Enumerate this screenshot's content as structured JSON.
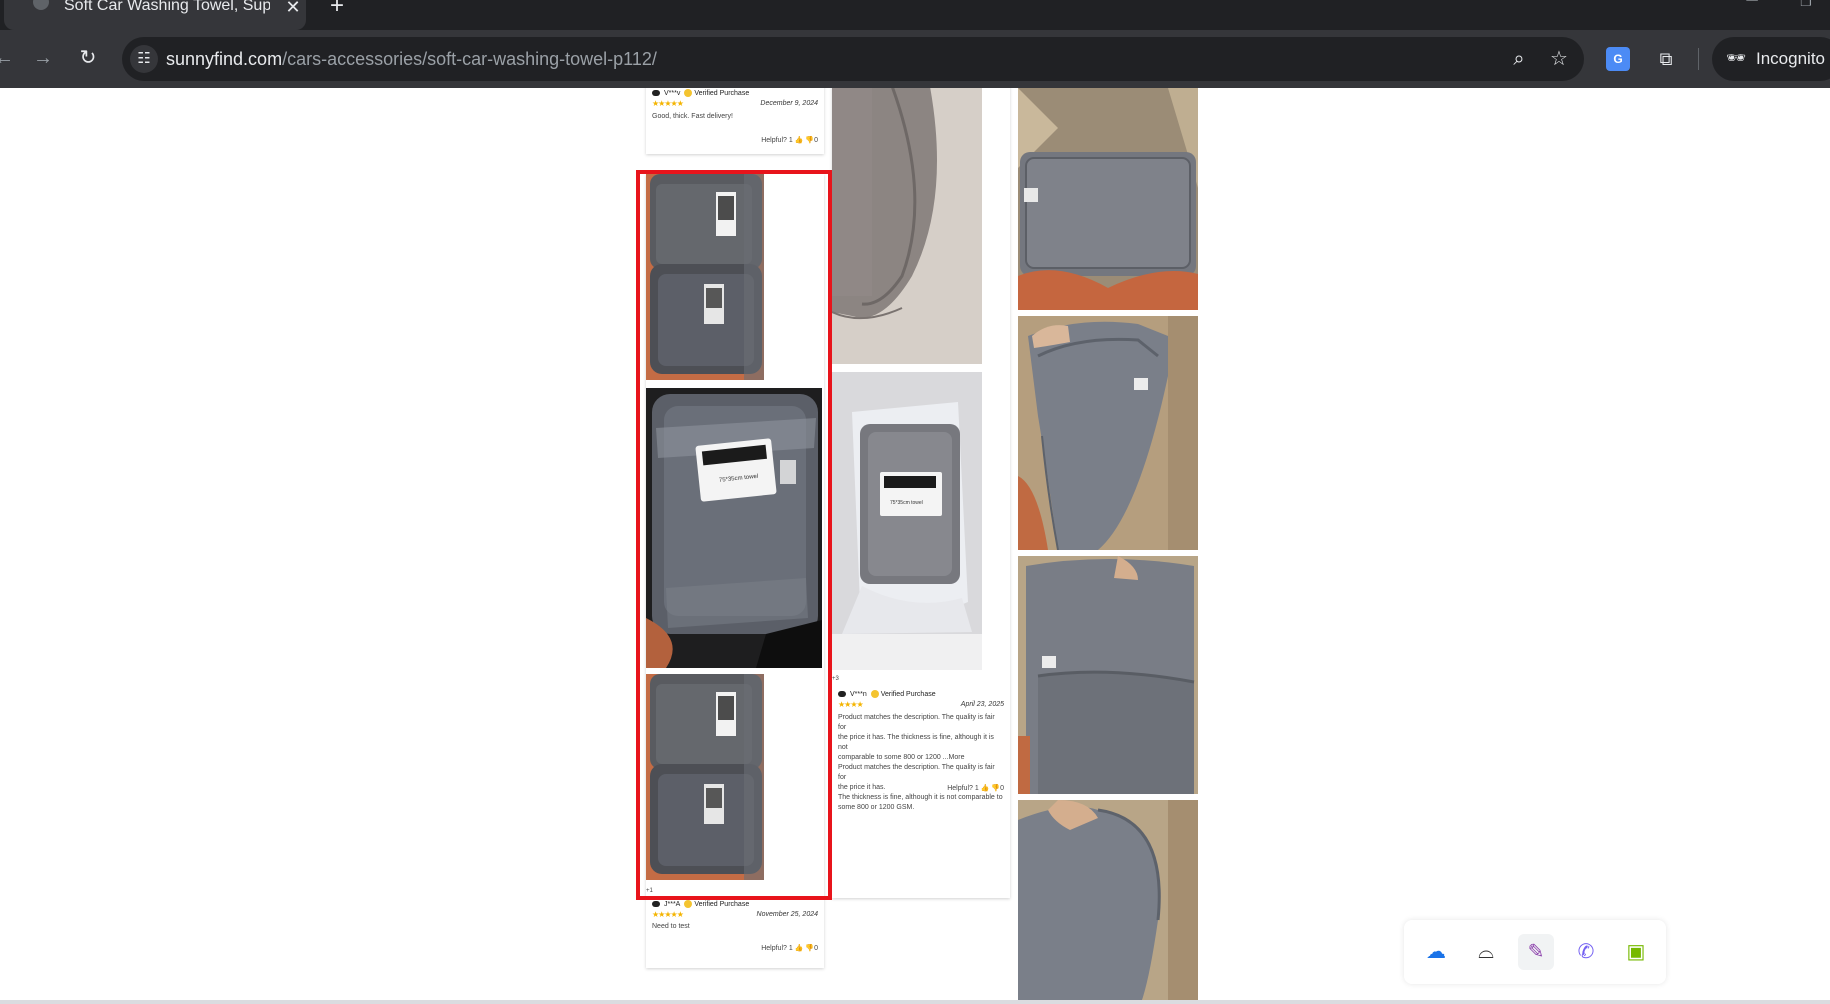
{
  "browser": {
    "tab_title": "Soft Car Washing Towel, Super Absorbent",
    "tab_close": "✕",
    "new_tab": "+",
    "url_host": "sunnyfind.com",
    "url_path": "/cars-accessories/soft-car-washing-towel-p112/",
    "incognito_label": "Incognito",
    "icons": {
      "back": "arrow-left-icon",
      "forward": "arrow-right-icon",
      "reload": "reload-icon",
      "site_info": "tune-icon",
      "zoom": "zoom-icon",
      "bookmark": "star-icon",
      "translate": "translate-icon",
      "extensions": "puzzle-icon",
      "incognito": "incognito-icon"
    },
    "colors": {
      "frame": "#202124",
      "toolbar": "#35363a",
      "text": "#e8eaed"
    }
  },
  "reviews": [
    {
      "user": "V***v",
      "verified": "Verified Purchase",
      "stars": "★★★★★",
      "date": "December 9, 2024",
      "text": "Good, thick. Fast delivery!",
      "helpful": "Helpful? 1",
      "helpful_no": "0"
    },
    {
      "user": "J***A",
      "verified": "Verified Purchase",
      "stars": "★★★★★",
      "date": "November 25, 2024",
      "text": "Need to test",
      "helpful": "Helpful? 1",
      "helpful_no": "0",
      "more_photos": "+1"
    },
    {
      "user": "V***n",
      "verified": "Verified Purchase",
      "stars": "★★★★",
      "date": "April 23, 2025",
      "text_lines": [
        "Product matches the description. The quality is fair for",
        "the price it has. The thickness is fine, although it is not",
        "comparable to some 800 or 1200 ...More",
        "Product matches the description. The quality is fair for",
        "the price it has.",
        "The thickness is fine, although it is not comparable to",
        "some 800 or 1200 GSM."
      ],
      "helpful": "Helpful? 1",
      "helpful_no": "0",
      "more_photos": "+3"
    }
  ],
  "photo_labels": {
    "package_label": "75*35cm towel",
    "package_label_2": "75*35cm towel"
  },
  "extension_tray": {
    "icons": [
      "cloud-icon",
      "arch-icon",
      "feather-icon",
      "viber-icon",
      "nvidia-icon"
    ],
    "colors": {
      "cloud": "#1a73e8",
      "feather": "#8e44ad",
      "viber": "#7360f2",
      "nvidia": "#76b900"
    }
  },
  "highlight_color": "#e8141b"
}
